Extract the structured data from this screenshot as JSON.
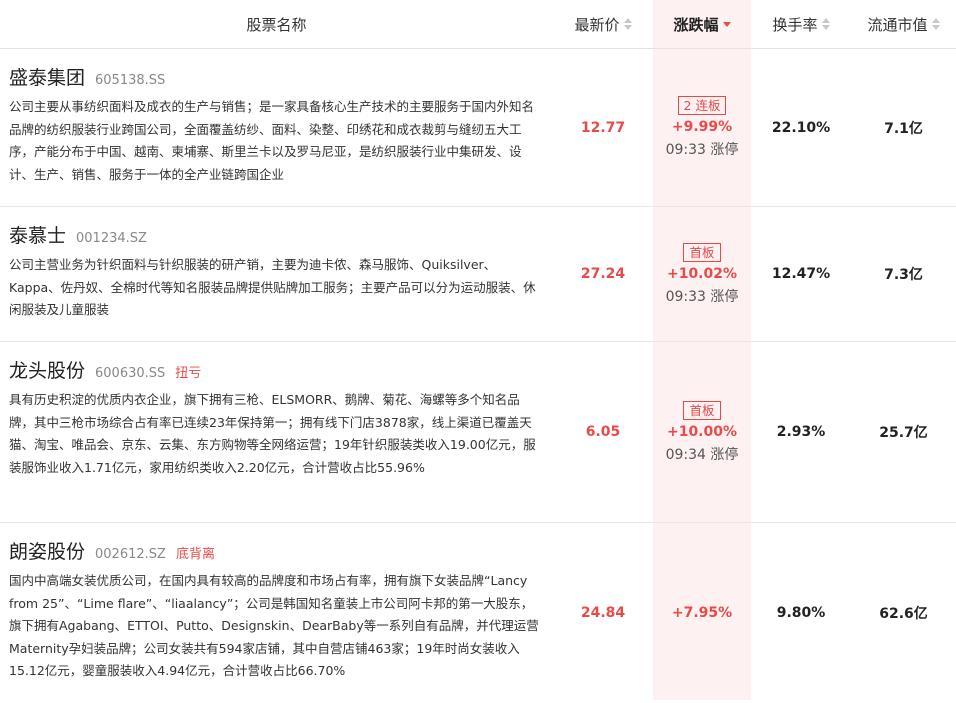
{
  "header": {
    "name": "股票名称",
    "price": "最新价",
    "change": "涨跌幅",
    "turnover": "换手率",
    "cap": "流通市值"
  },
  "colors": {
    "up_red": "#e84a4a",
    "highlight_bg": "#fdf1f1"
  },
  "rows": [
    {
      "name": "盛泰集团",
      "code": "605138.SS",
      "tag": "",
      "desc": "公司主要从事纺织面料及成衣的生产与销售；是一家具备核心生产技术的主要服务于国内外知名品牌的纺织服装行业跨国公司，全面覆盖纺纱、面料、染整、印绣花和成衣裁剪与缝纫五大工序，产能分布于中国、越南、柬埔寨、斯里兰卡以及罗马尼亚，是纺织服装行业中集研发、设计、生产、销售、服务于一体的全产业链跨国企业",
      "price": "12.77",
      "badge": "2 连板",
      "change": "+9.99%",
      "limit": "09:33 涨停",
      "turnover": "22.10%",
      "cap": "7.1亿"
    },
    {
      "name": "泰慕士",
      "code": "001234.SZ",
      "tag": "",
      "desc": "公司主营业务为针织面料与针织服装的研产销，主要为迪卡侬、森马服饰、Quiksilver、Kappa、佐丹奴、全棉时代等知名服装品牌提供贴牌加工服务；主要产品可以分为运动服装、休闲服装及儿童服装",
      "price": "27.24",
      "badge": "首板",
      "change": "+10.02%",
      "limit": "09:33 涨停",
      "turnover": "12.47%",
      "cap": "7.3亿"
    },
    {
      "name": "龙头股份",
      "code": "600630.SS",
      "tag": "扭亏",
      "desc": "具有历史积淀的优质内衣企业，旗下拥有三枪、ELSMORR、鹅牌、菊花、海螺等多个知名品牌，其中三枪市场综合占有率已连续23年保持第一；拥有线下门店3878家，线上渠道已覆盖天猫、淘宝、唯品会、京东、云集、东方购物等全网络运营；19年针织服装类收入19.00亿元，服装服饰业收入1.71亿元，家用纺织类收入2.20亿元，合计营收占比55.96%",
      "price": "6.05",
      "badge": "首板",
      "change": "+10.00%",
      "limit": "09:34 涨停",
      "turnover": "2.93%",
      "cap": "25.7亿"
    },
    {
      "name": "朗姿股份",
      "code": "002612.SZ",
      "tag": "底背离",
      "desc": "国内中高端女装优质公司，在国内具有较高的品牌度和市场占有率，拥有旗下女装品牌“Lancy from 25”、“Lime flare”、“liaalancy”；公司是韩国知名童装上市公司阿卡邦的第一大股东，旗下拥有Agabang、ETTOI、Putto、Designskin、DearBaby等一系列自有品牌，并代理运营Maternity孕妇装品牌；公司女装共有594家店铺，其中自营店铺463家；19年时尚女装收入15.12亿元，婴童服装收入4.94亿元，合计营收占比66.70%",
      "price": "24.84",
      "badge": "",
      "change": "+7.95%",
      "limit": "",
      "turnover": "9.80%",
      "cap": "62.6亿"
    }
  ]
}
